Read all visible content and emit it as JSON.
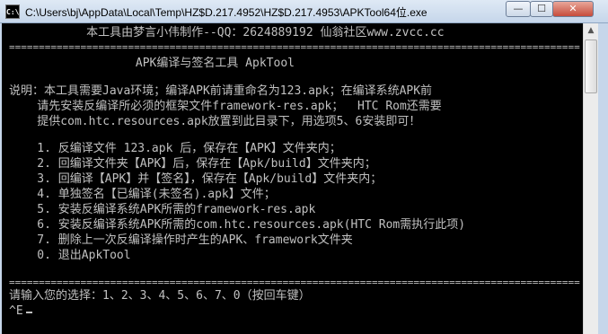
{
  "window": {
    "title": "C:\\Users\\bj\\AppData\\Local\\Temp\\HZ$D.217.4952\\HZ$D.217.4953\\APKTool64位.exe",
    "icon_text": "C:\\",
    "minimize_glyph": "—",
    "maximize_glyph": "☐",
    "close_glyph": "✕"
  },
  "scrollbar": {
    "up_arrow": "▲"
  },
  "console": {
    "header": "           本工具由梦言小伟制作--QQ：2624889192 仙翁社区www.zvcc.cc",
    "rule_top": "================================================================================================",
    "tool_title": "                  APK编译与签名工具 ApkTool",
    "desc_line1": "说明：本工具需要Java环境；编译APK前请重命名为123.apk；在编译系统APK前",
    "desc_line2": "    请先安装反编译所必须的框架文件framework-res.apk；  HTC Rom还需要",
    "desc_line3": "    提供com.htc.resources.apk放置到此目录下，用选项5、6安装即可！",
    "menu": [
      "    1. 反编译文件 123.apk 后，保存在【APK】文件夹内；",
      "    2. 回编译文件夹【APK】后，保存在【Apk/build】文件夹内；",
      "    3. 回编译【APK】并【签名】，保存在【Apk/build】文件夹内；",
      "    4. 单独签名【已编译(未签名).apk】文件；",
      "    5. 安装反编译系统APK所需的framework-res.apk",
      "    6. 安装反编译系统APK所需的com.htc.resources.apk(HTC Rom需执行此项)",
      "    7. 删除上一次反编译操作时产生的APK、framework文件夹",
      "    0. 退出ApkTool"
    ],
    "rule_bottom": "================================================================================================",
    "prompt": "请输入您的选择：1、2、3、4、5、6、7、0（按回车键）",
    "input_line": "^E"
  }
}
